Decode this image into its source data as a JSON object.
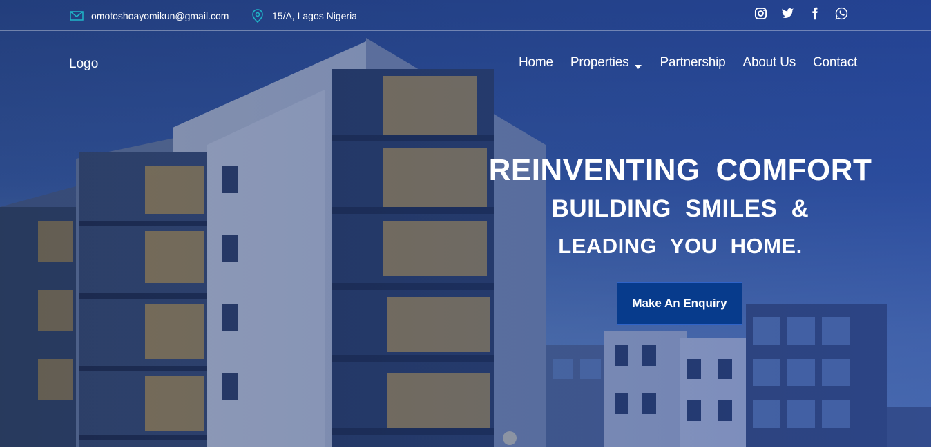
{
  "topbar": {
    "email": "omotoshoayomikun@gmail.com",
    "email_icon": "envelope-icon",
    "address": "15/A, Lagos Nigeria",
    "address_icon": "map-pin-icon",
    "socials": [
      "instagram-icon",
      "twitter-icon",
      "facebook-icon",
      "whatsapp-icon"
    ],
    "icon_color": "#1fb6c9"
  },
  "header": {
    "logo": "Logo",
    "nav": {
      "home": "Home",
      "properties": "Properties",
      "partnership": "Partnership",
      "about": "About Us",
      "contact": "Contact"
    }
  },
  "hero": {
    "line1": "REINVENTING COMFORT",
    "line2": "BUILDING SMILES &",
    "line3": "LEADING YOU HOME.",
    "cta_label": "Make An Enquiry",
    "cta_color": "#073b8c"
  }
}
